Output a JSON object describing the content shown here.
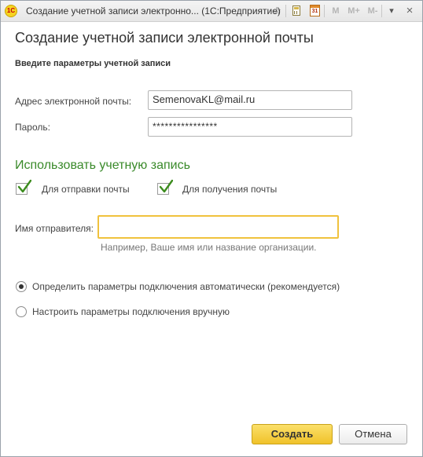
{
  "window": {
    "title": "Создание учетной записи электронно... (1С:Предприятие)",
    "app_logo": "1С",
    "calendar_day": "31",
    "m_labels": [
      "M",
      "M+",
      "M-"
    ],
    "close_glyph": "×",
    "menu_glyph": "▾",
    "star_glyph": "☆"
  },
  "form": {
    "title": "Создание учетной записи электронной почты",
    "subtitle": "Введите параметры учетной записи",
    "email_label": "Адрес электронной почты:",
    "email_value": "SemenovaKL@mail.ru",
    "password_label": "Пароль:",
    "password_value": "****************",
    "use_account_title": "Использовать учетную запись",
    "checkboxes": [
      {
        "label": "Для отправки почты",
        "checked": true
      },
      {
        "label": "Для получения почты",
        "checked": true
      }
    ],
    "sender_label": "Имя отправителя:",
    "sender_value": "",
    "sender_hint": "Например, Ваше имя или название организации.",
    "radios": [
      {
        "label": "Определить параметры подключения автоматически (рекомендуется)",
        "selected": true
      },
      {
        "label": "Настроить параметры подключения вручную",
        "selected": false
      }
    ],
    "create_button": "Создать",
    "cancel_button": "Отмена"
  },
  "colors": {
    "accent_green": "#3a8a2a",
    "primary_button": "#f0c22a",
    "focus_border": "#f0c23d"
  }
}
